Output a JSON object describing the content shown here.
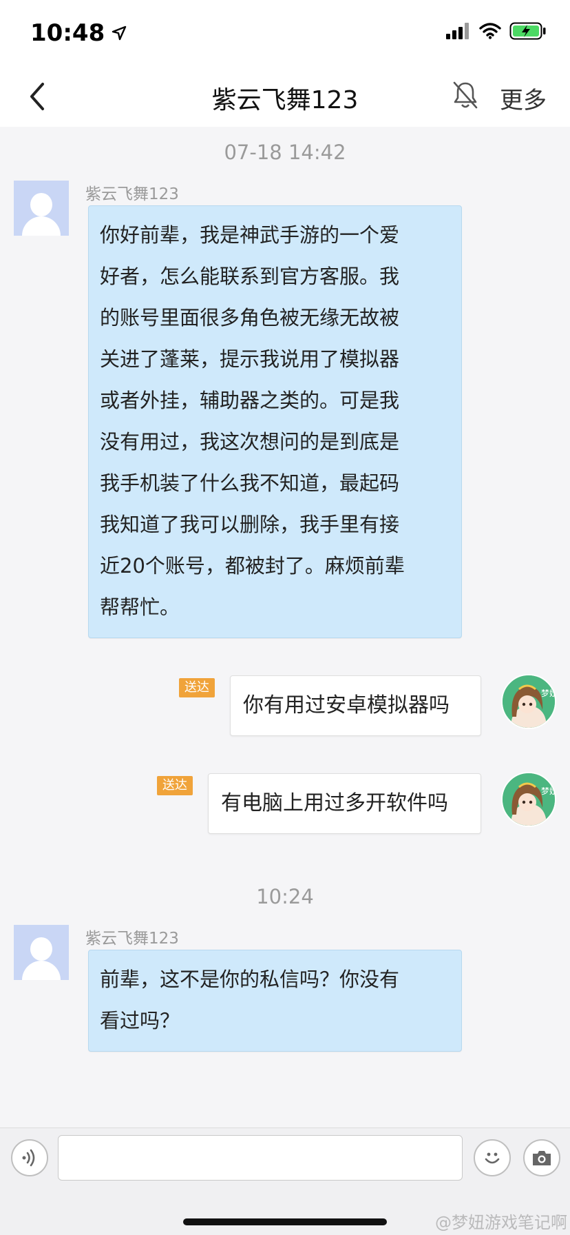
{
  "status_bar": {
    "time": "10:48",
    "location_icon": "location-arrow-icon",
    "signal_icon": "cellular-signal-icon",
    "wifi_icon": "wifi-icon",
    "battery_icon": "battery-charging-icon",
    "battery_color": "#4cd964"
  },
  "nav": {
    "back_icon": "chevron-left-icon",
    "title": "紫云飞舞123",
    "mute_icon": "bell-off-icon",
    "more_label": "更多"
  },
  "chat": {
    "timestamp_1": "07-18  14:42",
    "msg1": {
      "sender": "紫云飞舞123",
      "lines": [
        "你好前辈，我是神武手游的一个爱",
        "好者，怎么能联系到官方客服。我",
        "的账号里面很多角色被无缘无故被",
        "关进了蓬莱，提示我说用了模拟器",
        "或者外挂，辅助器之类的。可是我",
        "没有用过，我这次想问的是到底是",
        "我手机装了什么我不知道，最起码",
        "我知道了我可以删除，我手里有接",
        "近20个账号，都被封了。麻烦前辈",
        "帮帮忙。"
      ]
    },
    "reply1": {
      "status": "送达",
      "text": "你有用过安卓模拟器吗"
    },
    "reply2": {
      "status": "送达",
      "text": "有电脑上用过多开软件吗"
    },
    "avatar_label": "梦妞",
    "timestamp_2": "10:24",
    "msg2": {
      "sender": "紫云飞舞123",
      "lines": [
        "前辈，这不是你的私信吗？你没有",
        "看过吗？"
      ]
    },
    "bubble_in_color": "#cfe9fb",
    "badge_color": "#f0a33a"
  },
  "input_bar": {
    "voice_icon": "voice-wave-icon",
    "input_value": "",
    "emoji_icon": "smiley-icon",
    "camera_icon": "camera-icon"
  },
  "watermark": "@梦妞游戏笔记啊"
}
